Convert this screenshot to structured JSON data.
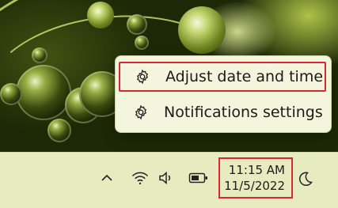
{
  "context_menu": {
    "items": [
      {
        "label": "Adjust date and time",
        "icon": "gear-icon"
      },
      {
        "label": "Notifications settings",
        "icon": "gear-icon"
      }
    ]
  },
  "taskbar": {
    "tray_icons": [
      "chevron-up-icon",
      "wifi-icon",
      "speaker-icon",
      "battery-icon"
    ],
    "clock": {
      "time": "11:15 AM",
      "date": "11/5/2022"
    },
    "focus_icon": "moon-icon"
  },
  "colors": {
    "highlight": "#d9282f",
    "taskbar_bg": "#e7ecc0",
    "menu_bg": "#f3f5dc"
  }
}
